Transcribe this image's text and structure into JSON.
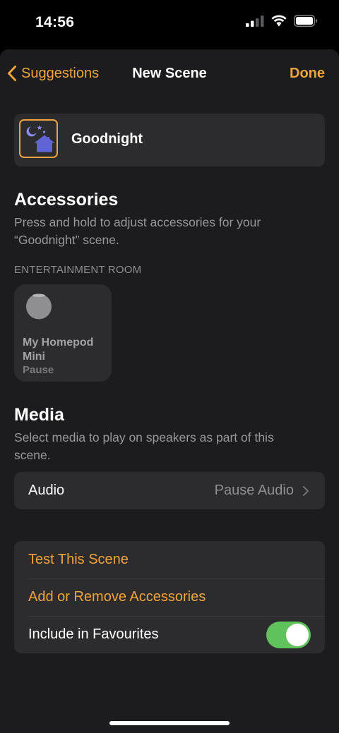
{
  "status_bar": {
    "time": "14:56",
    "icons": [
      "cellular-signal-icon",
      "wifi-icon",
      "battery-icon"
    ]
  },
  "nav": {
    "back_label": "Suggestions",
    "title": "New Scene",
    "done_label": "Done"
  },
  "scene": {
    "name": "Goodnight",
    "icon": "goodnight-house-icon"
  },
  "accessories": {
    "title": "Accessories",
    "description": "Press and hold to adjust accessories for your “Goodnight” scene.",
    "room_label": "ENTERTAINMENT ROOM",
    "tiles": [
      {
        "name": "My Homepod Mini",
        "status": "Pause",
        "icon": "homepod-mini-icon"
      }
    ]
  },
  "media": {
    "title": "Media",
    "description": "Select media to play on speakers as part of this scene.",
    "audio_label": "Audio",
    "audio_value": "Pause Audio"
  },
  "actions": {
    "test_scene": "Test This Scene",
    "add_remove": "Add or Remove Accessories",
    "favourites_label": "Include in Favourites",
    "favourites_on": true
  },
  "colors": {
    "accent": "#f0a53c",
    "toggle_on": "#5fc25d",
    "background": "#1c1c1e",
    "card": "#2c2c2e"
  }
}
